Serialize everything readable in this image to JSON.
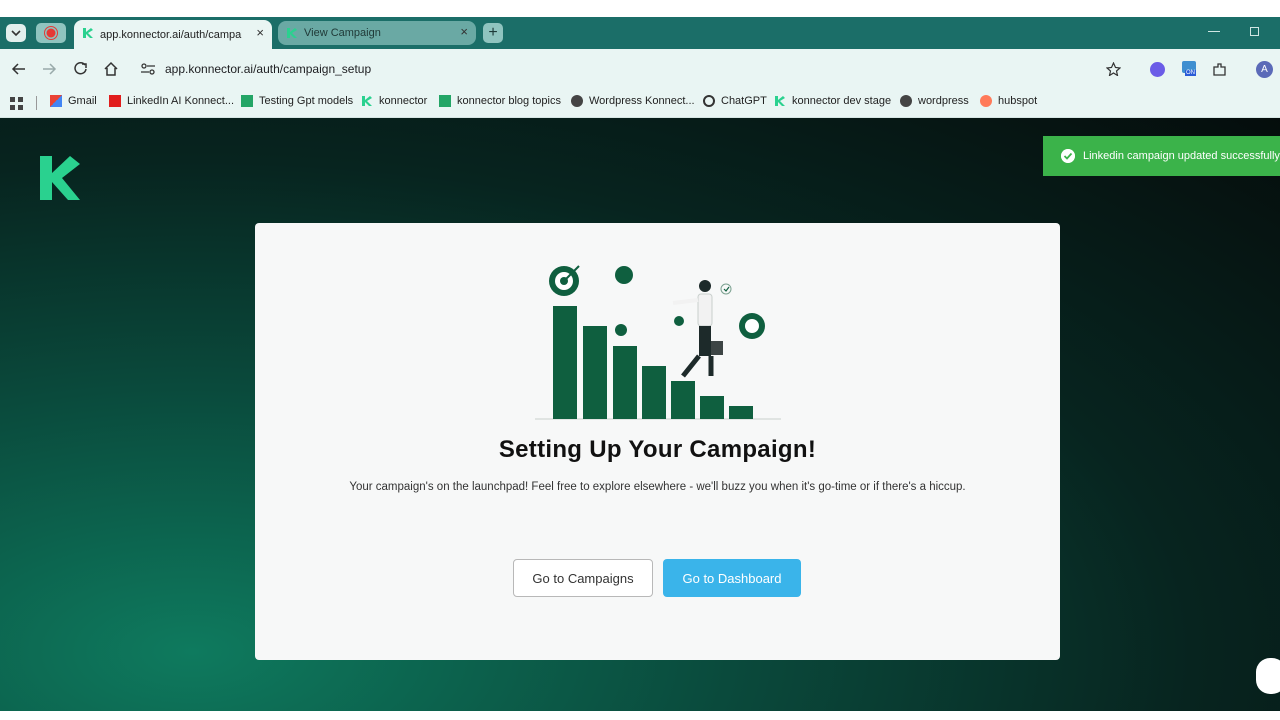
{
  "browser": {
    "tabs": [
      {
        "title": "app.konnector.ai/auth/campaig",
        "active": true
      },
      {
        "title": "View Campaign",
        "active": false
      }
    ],
    "url": "app.konnector.ai/auth/campaign_setup",
    "bookmarks": [
      "Gmail",
      "LinkedIn AI Konnect...",
      "Testing Gpt models",
      "konnector",
      "konnector blog topics",
      "Wordpress Konnect...",
      "ChatGPT",
      "konnector dev stage",
      "wordpress",
      "hubspot"
    ],
    "extension_badge_on": "ON",
    "profile_initial": "A",
    "close_glyph": "×",
    "new_tab_glyph": "+"
  },
  "toast": {
    "message": "Linkedin campaign updated successfully"
  },
  "card": {
    "title": "Setting Up Your Campaign!",
    "subtitle": "Your campaign's on the launchpad! Feel free to explore elsewhere - we'll buzz you when it's go-time or if there's a hiccup.",
    "buttons": {
      "campaigns": "Go to Campaigns",
      "dashboard": "Go to Dashboard"
    }
  },
  "colors": {
    "brand": "#1b6e68",
    "accent": "#3ab4ea",
    "success": "#3bb34a",
    "logo": "#2ad18f",
    "illustration": "#0f5f3f"
  }
}
